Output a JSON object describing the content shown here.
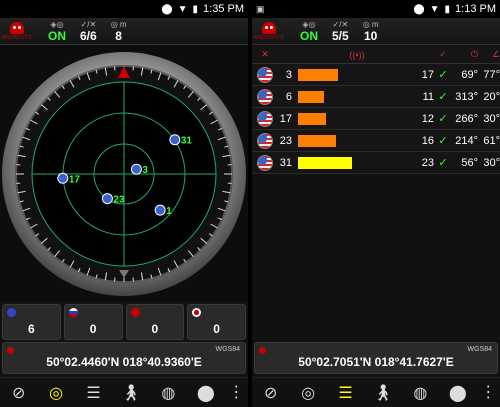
{
  "status_left": {
    "time": "1:35 PM"
  },
  "status_right": {
    "time": "1:13 PM"
  },
  "left": {
    "fix": "ON",
    "sats": "6/6",
    "accuracy": "8",
    "counts": [
      "6",
      "0",
      "0",
      "0"
    ],
    "datum": "WGS84",
    "coords": "50°02.4460'N  018°40.9360'E",
    "radar_labels": [
      "31",
      "3",
      "17",
      "23",
      "1"
    ],
    "compass_n": "N"
  },
  "right": {
    "fix": "ON",
    "sats": "5/5",
    "accuracy": "10",
    "datum": "WGS84",
    "coords": "50°02.7051'N  018°41.7627'E",
    "rows": [
      {
        "prn": "3",
        "snr": "17",
        "az": "69°",
        "el": "77°",
        "bar": 0.34,
        "color": "#ff7f00"
      },
      {
        "prn": "6",
        "snr": "11",
        "az": "313°",
        "el": "20°",
        "bar": 0.22,
        "color": "#ff7f00"
      },
      {
        "prn": "17",
        "snr": "12",
        "az": "266°",
        "el": "30°",
        "bar": 0.24,
        "color": "#ff7f00"
      },
      {
        "prn": "23",
        "snr": "16",
        "az": "214°",
        "el": "61°",
        "bar": 0.32,
        "color": "#ff7f00"
      },
      {
        "prn": "31",
        "snr": "23",
        "az": "56°",
        "el": "30°",
        "bar": 0.46,
        "color": "#ffff00"
      }
    ]
  },
  "colors": {
    "green": "#33ff33",
    "orange": "#ff7f00",
    "yellow": "#ffff00",
    "red": "#cc0000"
  }
}
